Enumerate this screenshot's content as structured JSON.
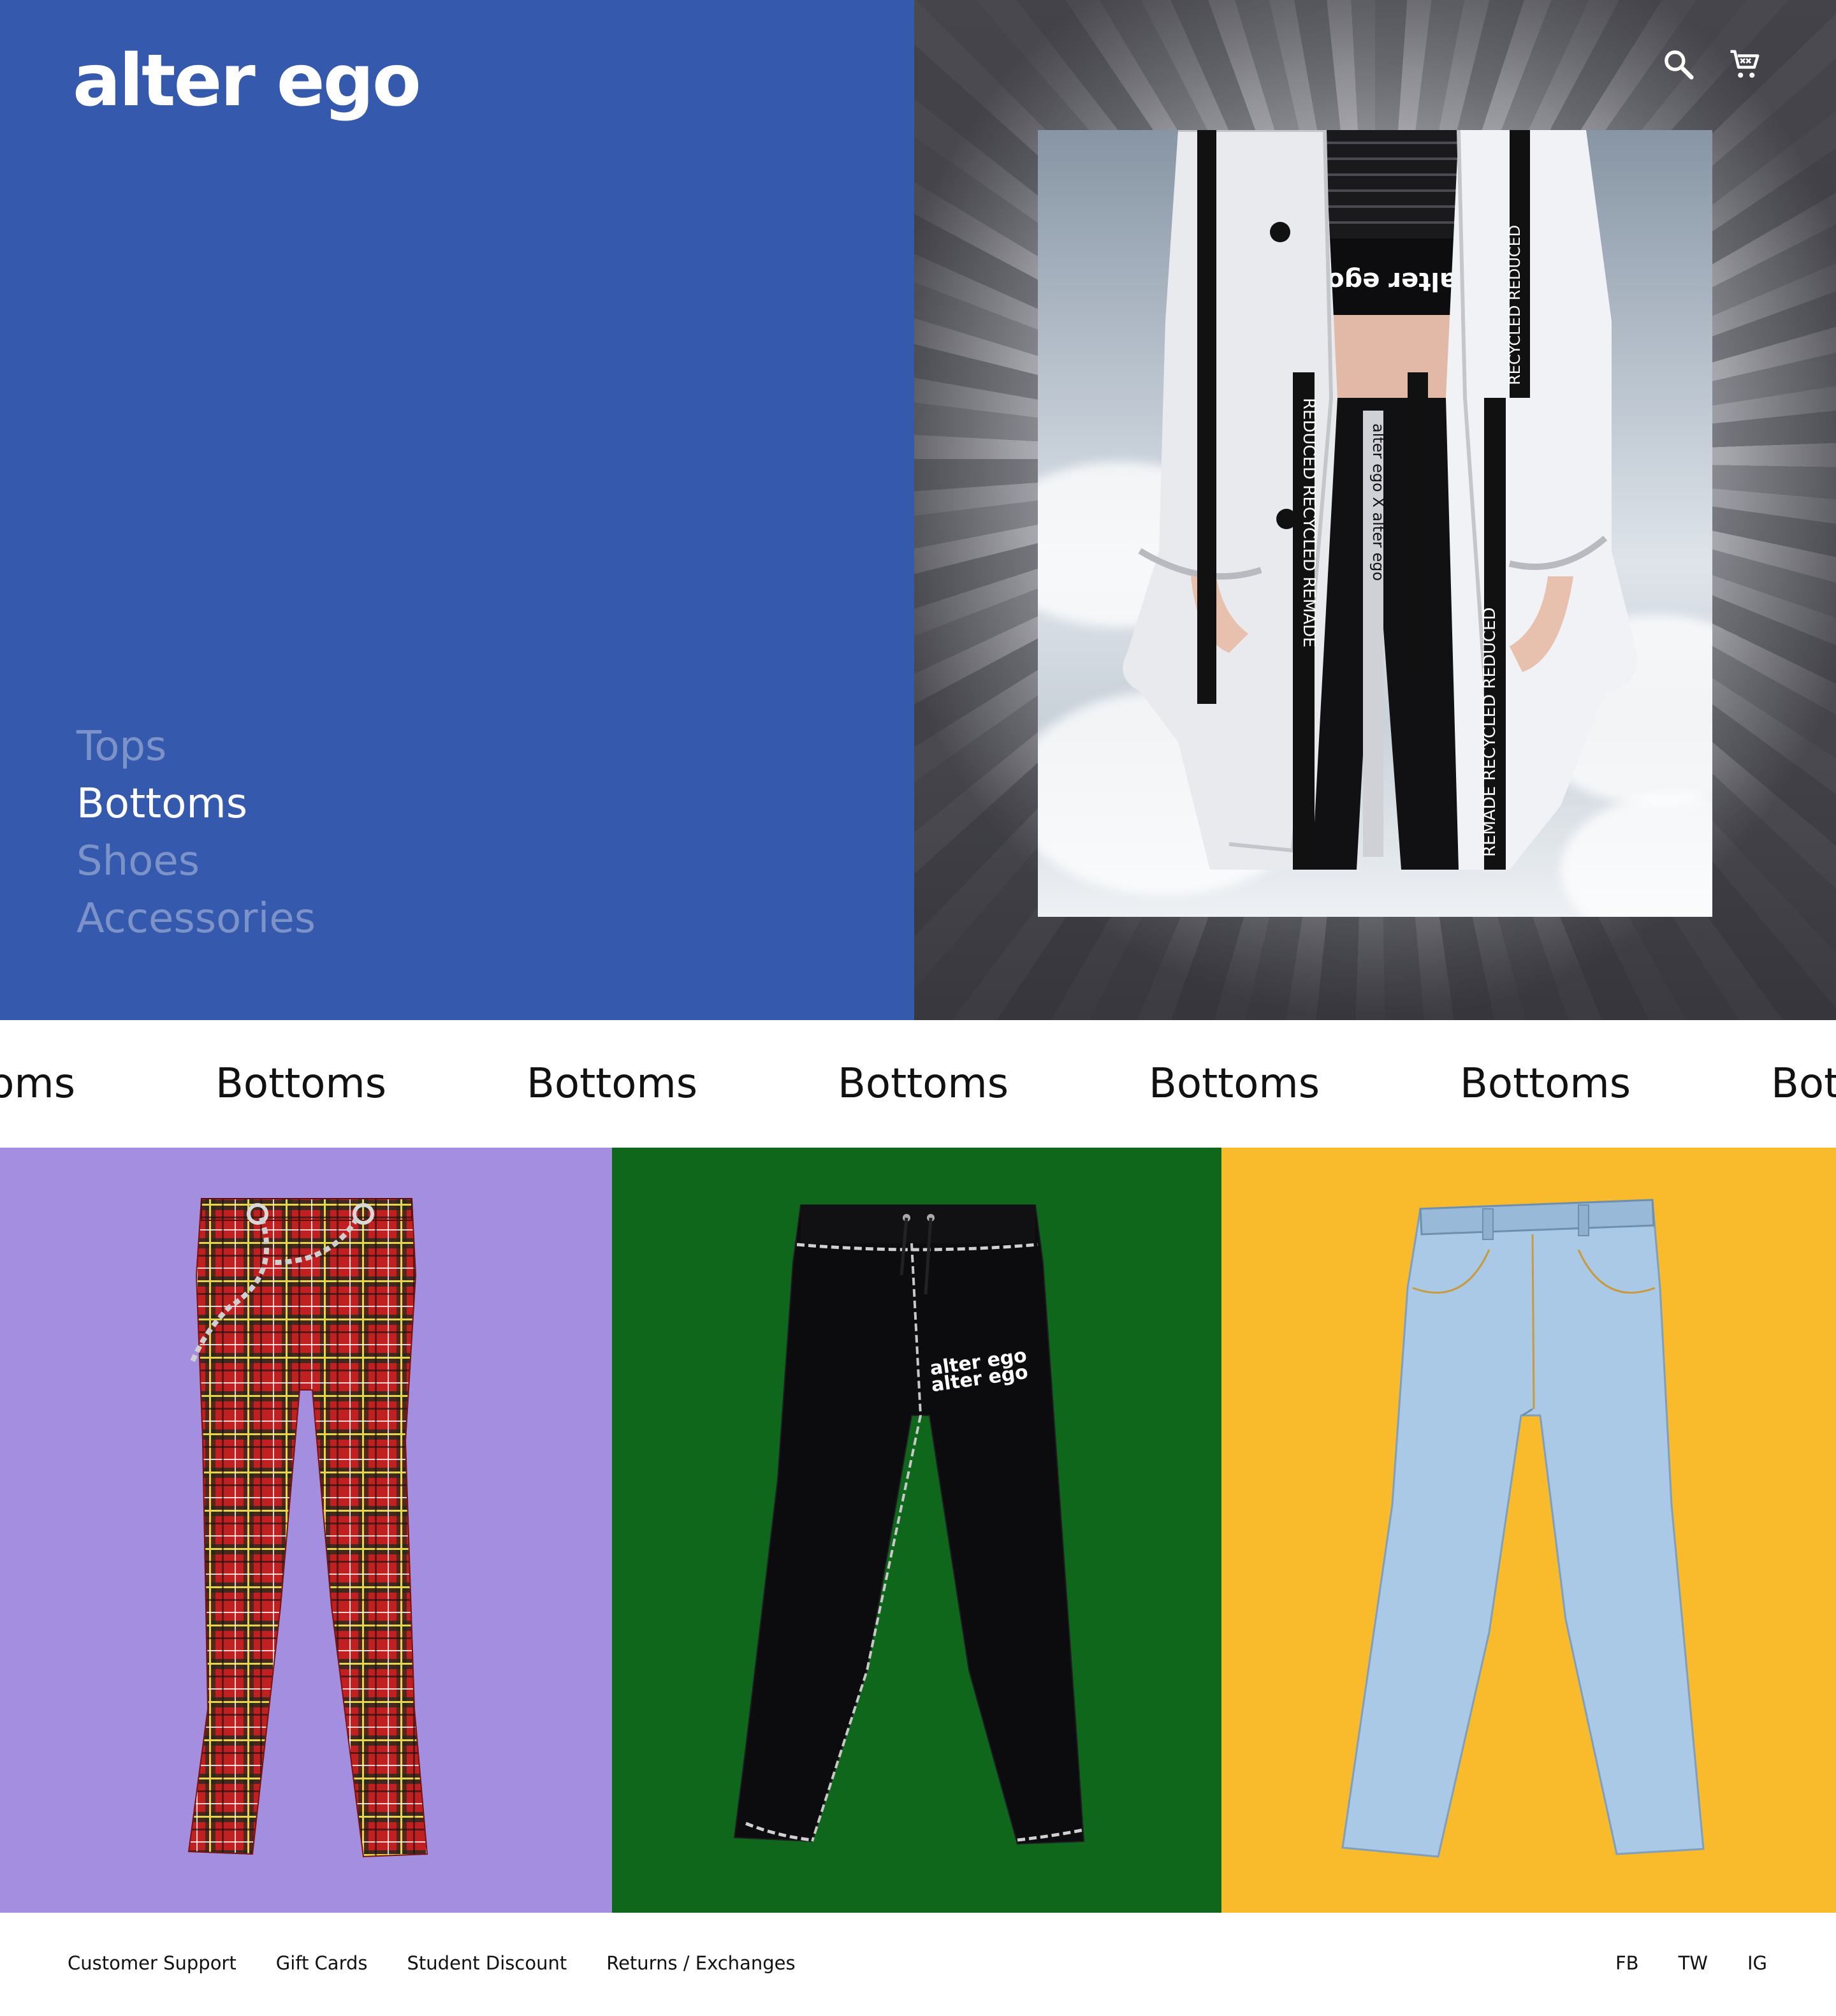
{
  "brand": {
    "logo_text": "alter ego"
  },
  "header": {
    "icons": [
      "search-icon",
      "cart-icon"
    ]
  },
  "categories": [
    {
      "label": "Tops",
      "active": false
    },
    {
      "label": "Bottoms",
      "active": true
    },
    {
      "label": "Shoes",
      "active": false
    },
    {
      "label": "Accessories",
      "active": false
    }
  ],
  "marquee": {
    "items": [
      "Bottoms",
      "Bottoms",
      "Bottoms",
      "Bottoms",
      "Bottoms",
      "Bottoms",
      "Bottoms"
    ]
  },
  "products": [
    {
      "name": "plaid-flare-pants",
      "background": "#a38ee0"
    },
    {
      "name": "black-sweatpants",
      "background": "#0e671a",
      "print_text": "alter ego"
    },
    {
      "name": "light-wash-jeans",
      "background": "#f9bb2b"
    }
  ],
  "colors": {
    "hero_blue": "#3559ad",
    "inactive_nav": "rgba(255,255,255,0.35)"
  },
  "footer": {
    "links": [
      "Customer Support",
      "Gift Cards",
      "Student Discount",
      "Returns / Exchanges"
    ],
    "social": [
      "FB",
      "TW",
      "IG"
    ]
  }
}
